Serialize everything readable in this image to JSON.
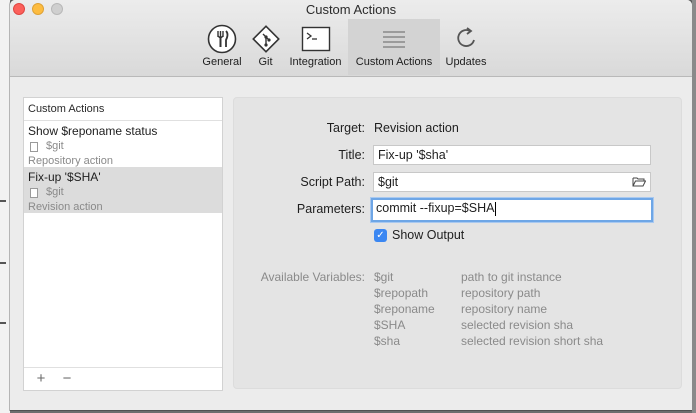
{
  "window": {
    "title": "Custom Actions"
  },
  "toolbar": {
    "items": [
      {
        "label": "General",
        "icon": "fork-icon",
        "active": false
      },
      {
        "label": "Git",
        "icon": "git-diamond-icon",
        "active": false
      },
      {
        "label": "Integration",
        "icon": "terminal-icon",
        "active": false
      },
      {
        "label": "Custom Actions",
        "icon": "list-lines-icon",
        "active": true
      },
      {
        "label": "Updates",
        "icon": "refresh-icon",
        "active": false
      }
    ]
  },
  "actions_list": {
    "header": "Custom Actions",
    "items": [
      {
        "title": "Show $reponame status",
        "subtitle": "$git",
        "type": "Repository action",
        "selected": false
      },
      {
        "title": "Fix-up '$SHA'",
        "subtitle": "$git",
        "type": "Revision action",
        "selected": true
      }
    ],
    "add_label": "+",
    "remove_label": "−"
  },
  "detail": {
    "target_label": "Target:",
    "target_value": "Revision action",
    "title_label": "Title:",
    "title_value": "Fix-up '$sha'",
    "script_label": "Script Path:",
    "script_value": "$git",
    "params_label": "Parameters:",
    "params_value": "commit --fixup=$SHA",
    "show_output_label": "Show Output",
    "show_output_checked": true,
    "vars_label": "Available Variables:",
    "variables": [
      {
        "name": "$git",
        "desc": "path to git instance"
      },
      {
        "name": "$repopath",
        "desc": "repository path"
      },
      {
        "name": "$reponame",
        "desc": "repository name"
      },
      {
        "name": "$SHA",
        "desc": "selected revision sha"
      },
      {
        "name": "$sha",
        "desc": "selected revision short sha"
      }
    ]
  },
  "colors": {
    "accent": "#3b87f2",
    "focus_ring": "#6ea6e6"
  }
}
